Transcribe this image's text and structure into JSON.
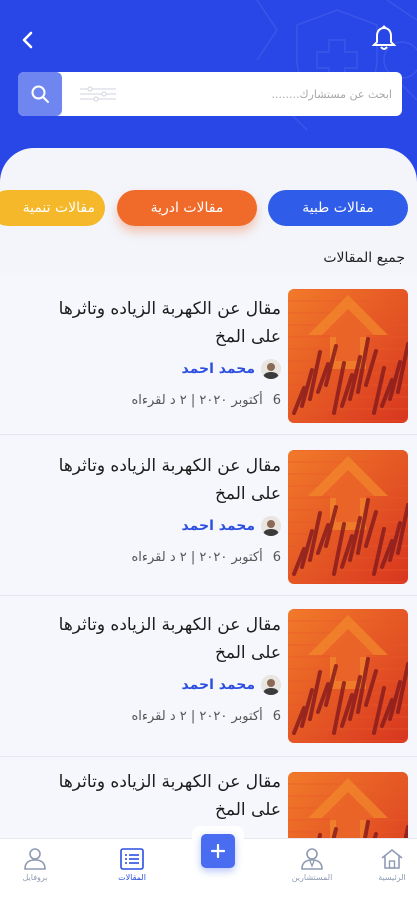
{
  "colors": {
    "primary": "#2946e6",
    "orange": "#f06a2a",
    "yellow": "#f5b82a",
    "link": "#2c4fe0"
  },
  "header": {
    "back_icon": "chevron-left-icon",
    "bell_icon": "bell-icon"
  },
  "search": {
    "placeholder": "ابحث عن مستشارك........",
    "icon": "search-icon"
  },
  "categories": [
    "مقالات طبية",
    "مقالات ادرية",
    "مقالات تنمية"
  ],
  "section_title": "جميع المقالات",
  "articles": [
    {
      "title": "مقال عن الكهربة الزياده وتاثرها على المخ",
      "author": "محمد احمد",
      "day": "6",
      "date_read": "أكتوبر ٢٠٢٠ | ٢ د لقرءاه"
    },
    {
      "title": "مقال عن الكهربة الزياده وتاثرها على المخ",
      "author": "محمد احمد",
      "day": "6",
      "date_read": "أكتوبر ٢٠٢٠ | ٢ د لقرءاه"
    },
    {
      "title": "مقال عن الكهربة الزياده وتاثرها على المخ",
      "author": "محمد احمد",
      "day": "6",
      "date_read": "أكتوبر ٢٠٢٠ | ٢ د لقرءاه"
    },
    {
      "title": "مقال عن الكهربة الزياده وتاثرها على المخ",
      "author": "",
      "day": "",
      "date_read": ""
    }
  ],
  "bottom_nav": {
    "home": "الرئيسية",
    "consultants": "المستشارين",
    "add_icon": "plus-icon",
    "articles": "المقالات",
    "profile": "بروفايل"
  }
}
